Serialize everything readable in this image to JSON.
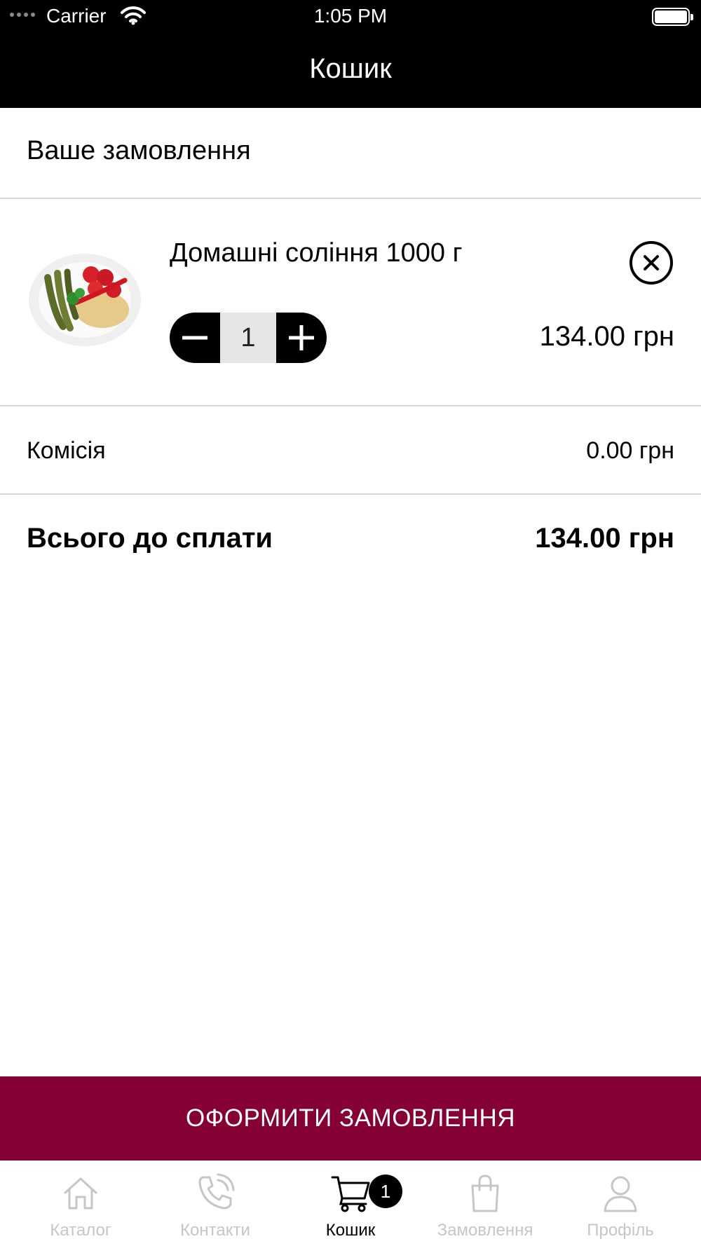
{
  "status_bar": {
    "carrier": "Carrier",
    "time": "1:05 PM"
  },
  "nav": {
    "title": "Кошик"
  },
  "order": {
    "heading": "Ваше замовлення",
    "items": [
      {
        "name": "Домашні соління 1000 г",
        "quantity": "1",
        "price": "134.00 грн"
      }
    ],
    "commission_label": "Комісія",
    "commission_value": "0.00 грн",
    "total_label": "Всього до сплати",
    "total_value": "134.00 грн"
  },
  "checkout_button": "ОФОРМИТИ ЗАМОВЛЕННЯ",
  "tabbar": {
    "items": [
      {
        "label": "Каталог",
        "icon": "home-icon",
        "active": false
      },
      {
        "label": "Контакти",
        "icon": "phone-icon",
        "active": false
      },
      {
        "label": "Кошик",
        "icon": "cart-icon",
        "active": true,
        "badge": "1"
      },
      {
        "label": "Замовлення",
        "icon": "shopping-bag-icon",
        "active": false
      },
      {
        "label": "Профіль",
        "icon": "user-icon",
        "active": false
      }
    ]
  },
  "colors": {
    "accent": "#850034",
    "header": "#000000",
    "inactive_tab": "#c6c6c6"
  }
}
